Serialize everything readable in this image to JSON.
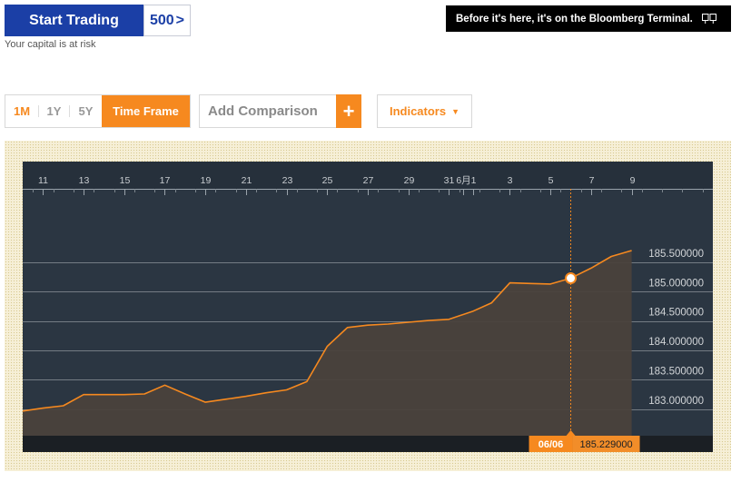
{
  "promo": {
    "start_label": "Start Trading",
    "badge_label": "500",
    "badge_arrow": ">",
    "risk_text": "Your capital is at risk",
    "bloomberg_text": "Before it's here, it's on the Bloomberg Terminal.",
    "bloomberg_icon": "monitor-icon"
  },
  "toolbar": {
    "periods": [
      "1M",
      "1Y",
      "5Y"
    ],
    "time_frame_label": "Time Frame",
    "comparison_placeholder": "Add Comparison",
    "plus_label": "+",
    "indicators_label": "Indicators",
    "indicators_caret": "▼"
  },
  "colors": {
    "accent": "#f6891f",
    "chart_bg": "#2b3642",
    "area_fill": "#4a423c",
    "brand_blue": "#1b3fa6"
  },
  "chart_data": {
    "type": "area",
    "x_ticks": [
      "11",
      "13",
      "15",
      "17",
      "19",
      "21",
      "23",
      "25",
      "27",
      "29",
      "31",
      "6月",
      "1",
      "3",
      "5",
      "7",
      "9"
    ],
    "x_tick_days": [
      11,
      13,
      15,
      17,
      19,
      21,
      23,
      25,
      27,
      29,
      31,
      31.7,
      32.2,
      34,
      36,
      38,
      40
    ],
    "x_range": [
      10,
      44
    ],
    "y_ticks": [
      "183.000000",
      "183.500000",
      "184.000000",
      "184.500000",
      "185.000000",
      "185.500000"
    ],
    "y_tick_values": [
      183.0,
      183.5,
      184.0,
      184.5,
      185.0,
      185.5
    ],
    "ylim": [
      182.55,
      186.75
    ],
    "series": [
      {
        "x": [
          10,
          11,
          12,
          13,
          14,
          15,
          16,
          17,
          18,
          19,
          20,
          21,
          22,
          23,
          24,
          25,
          26,
          27,
          28,
          29,
          30,
          31,
          32.2,
          33.1,
          34,
          35,
          36,
          37,
          38,
          39,
          40
        ],
        "y": [
          182.97,
          183.02,
          183.06,
          183.25,
          183.25,
          183.25,
          183.26,
          183.41,
          183.26,
          183.12,
          183.17,
          183.22,
          183.28,
          183.33,
          183.47,
          184.07,
          184.39,
          184.43,
          184.45,
          184.48,
          184.51,
          184.53,
          184.67,
          184.81,
          185.15,
          185.14,
          185.13,
          185.229,
          185.4,
          185.6,
          185.7
        ]
      }
    ],
    "cursor": {
      "x": 37,
      "date_label": "06/06",
      "value_label": "185.229000",
      "value": 185.229
    },
    "grid": true
  }
}
